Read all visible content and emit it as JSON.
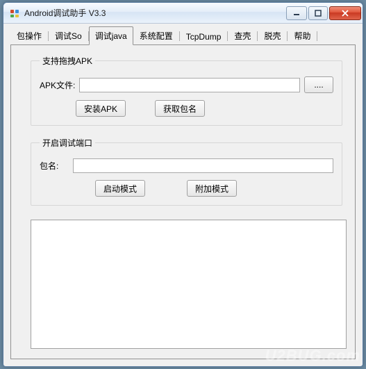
{
  "window": {
    "title": "Android调试助手 V3.3"
  },
  "tabs": [
    {
      "label": "包操作"
    },
    {
      "label": "调试So"
    },
    {
      "label": "调试java"
    },
    {
      "label": "系统配置"
    },
    {
      "label": "TcpDump"
    },
    {
      "label": "查壳"
    },
    {
      "label": "脱壳"
    },
    {
      "label": "帮助"
    }
  ],
  "active_tab_index": 2,
  "group_apk": {
    "legend": "支持拖拽APK",
    "file_label": "APK文件:",
    "file_value": "",
    "browse_label": "....",
    "install_label": "安装APK",
    "getpkg_label": "获取包名"
  },
  "group_debug": {
    "legend": "开启调试端口",
    "pkg_label": "包名:",
    "pkg_value": "",
    "launch_label": "启动模式",
    "attach_label": "附加模式"
  },
  "output_text": "",
  "watermark": "U2BUG.com"
}
